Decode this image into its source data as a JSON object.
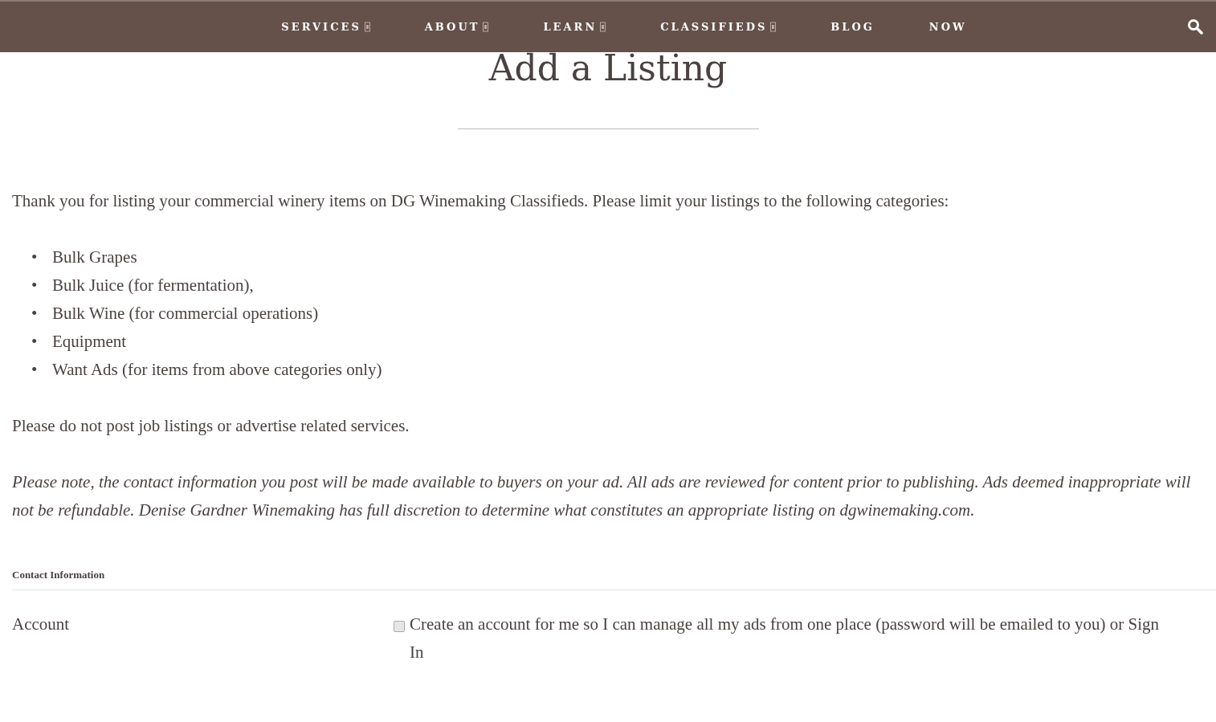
{
  "nav": {
    "items": [
      {
        "label": "SERVICES",
        "dropdown": true
      },
      {
        "label": "ABOUT",
        "dropdown": true
      },
      {
        "label": "LEARN",
        "dropdown": true
      },
      {
        "label": "CLASSIFIEDS",
        "dropdown": true
      },
      {
        "label": "BLOG",
        "dropdown": false
      },
      {
        "label": "NOW",
        "dropdown": false
      }
    ]
  },
  "page": {
    "title": "Add a Listing",
    "intro": "Thank you for listing your commercial winery items on DG Winemaking Classifieds. Please limit your listings to the following categories:",
    "categories": [
      {
        "bullet": "•",
        "text": "Bulk Grapes"
      },
      {
        "bullet": "•",
        "text": "Bulk Juice (for fermentation),"
      },
      {
        "bullet": "•",
        "text": "Bulk Wine (for commercial operations)"
      },
      {
        "bullet": "•",
        "text": "Equipment"
      },
      {
        "bullet": "•",
        "text": "Want Ads (for items from above categories only)"
      }
    ],
    "warning": "Please do not post job listings or advertise related services.",
    "note": "Please note, the contact information you post will be made available to buyers on your ad. All ads are reviewed for content prior to publishing. Ads deemed inappropriate will not be refundable. Denise Gardner Winemaking has full discretion to determine what constitutes an appropriate listing on dgwinemaking.com."
  },
  "form": {
    "section": "Contact Information",
    "fields": [
      {
        "label": "Account",
        "checkbox_label": "Create an account for me so I can manage all my ads from one place (password will be emailed to you) or Sign In",
        "checked": false
      }
    ]
  }
}
